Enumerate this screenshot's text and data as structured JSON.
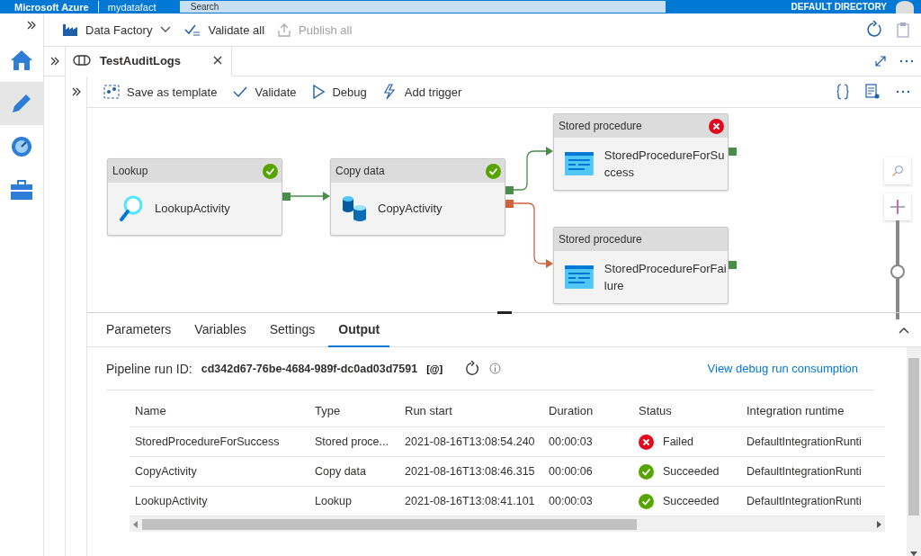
{
  "top_bar": {
    "brand": "Microsoft Azure",
    "factory": "mydatafact",
    "search": {
      "placeholder": "Search"
    },
    "directory": "DEFAULT DIRECTORY"
  },
  "rail": [
    {
      "kind": "home",
      "selected": false
    },
    {
      "kind": "author",
      "selected": true
    },
    {
      "kind": "monitor",
      "selected": false
    },
    {
      "kind": "manage",
      "selected": false
    }
  ],
  "factory_toolbar": {
    "factory": "Data Factory",
    "validate_all": "Validate all",
    "publish_all": "Publish all"
  },
  "tabs": [
    {
      "label": "TestAuditLogs",
      "selected": true
    }
  ],
  "pipeline_toolbar": [
    "Save as template",
    "Validate",
    "Debug",
    "Add trigger"
  ],
  "activities": [
    {
      "type": "Lookup",
      "name": "LookupActivity",
      "kind": "lookup",
      "succeeded": true,
      "failed": false
    },
    {
      "type": "Copy data",
      "name": "CopyActivity",
      "kind": "copy",
      "succeeded": true,
      "failed": false
    },
    {
      "type": "Stored procedure",
      "name": "StoredProcedureForSuccess",
      "kind": "sproc",
      "succeeded": false,
      "failed": true
    },
    {
      "type": "Stored procedure",
      "name": "StoredProcedureForFailure",
      "kind": "sproc",
      "succeeded": false,
      "failed": false
    }
  ],
  "zoom": {
    "level": 0.47
  },
  "connectors": [
    {
      "kind": "success"
    },
    {
      "kind": "success"
    },
    {
      "kind": "failure"
    }
  ],
  "panel_tabs": [
    {
      "label": "Parameters",
      "selected": false
    },
    {
      "label": "Variables",
      "selected": false
    },
    {
      "label": "Settings",
      "selected": false
    },
    {
      "label": "Output",
      "selected": true
    }
  ],
  "output": {
    "run_id_label": "Pipeline run ID:",
    "run_id": "cd342d67-76be-4684-989f-dc0ad03d7591",
    "copy_mark": "[@]",
    "consumption_link": "View debug run consumption",
    "columns": [
      "Name",
      "Type",
      "Run start",
      "Duration",
      "Status",
      "Integration runtime"
    ],
    "rows": [
      {
        "name": "StoredProcedureForSuccess",
        "type": "Stored proce...",
        "run_start": "2021-08-16T13:08:54.240",
        "duration": "00:00:03",
        "status": "Failed",
        "kind": "failed",
        "runtime": "DefaultIntegrationRunti"
      },
      {
        "name": "CopyActivity",
        "type": "Copy data",
        "run_start": "2021-08-16T13:08:46.315",
        "duration": "00:00:06",
        "status": "Succeeded",
        "kind": "succeeded",
        "runtime": "DefaultIntegrationRunti"
      },
      {
        "name": "LookupActivity",
        "type": "Lookup",
        "run_start": "2021-08-16T13:08:41.101",
        "duration": "00:00:03",
        "status": "Succeeded",
        "kind": "succeeded",
        "runtime": "DefaultIntegrationRunti"
      }
    ]
  }
}
